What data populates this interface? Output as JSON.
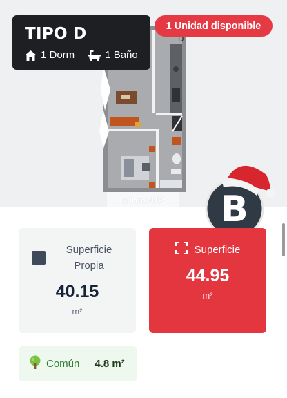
{
  "unit_type": {
    "title": "TIPO D",
    "bedrooms": "1 Dorm",
    "bathrooms": "1 Baño"
  },
  "availability_badge": "1 Unidad disponible",
  "plan_watermark": "inmoUP",
  "brand_letter": "B",
  "own_surface": {
    "label": "Superficie Propia",
    "value": "40.15",
    "unit": "m²"
  },
  "total_surface": {
    "label": "Superficie",
    "value": "44.95",
    "unit": "m²"
  },
  "common_surface": {
    "label": "Común",
    "value": "4.8 m²"
  },
  "colors": {
    "accent_red": "#e4363f",
    "dark": "#1d1f22",
    "green": "#2e7d32"
  },
  "icons": [
    "home-icon",
    "bathtub-icon",
    "expand-icon",
    "tree-icon",
    "santa-hat-icon"
  ]
}
